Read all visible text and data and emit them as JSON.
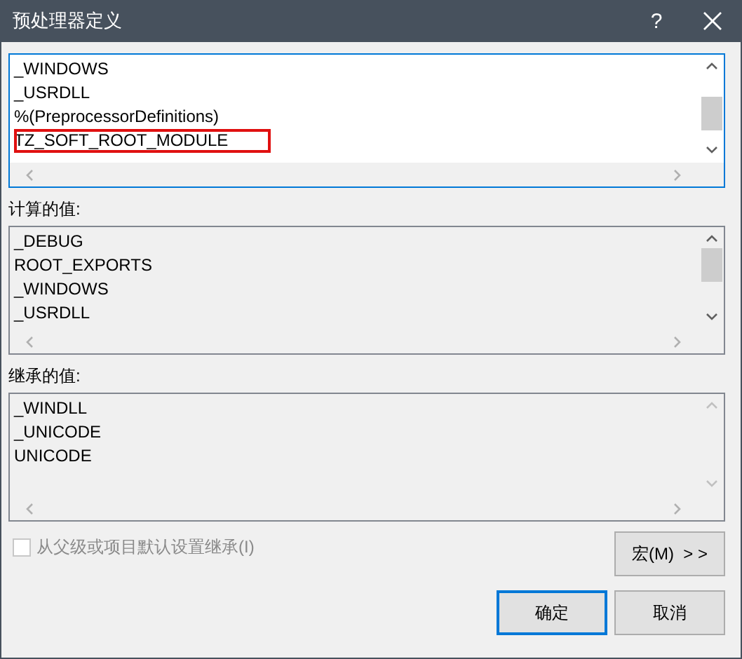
{
  "window": {
    "title": "预处理器定义",
    "help": "?"
  },
  "editor": {
    "focused": true,
    "lines": [
      {
        "text": "_WINDOWS",
        "highlighted": false
      },
      {
        "text": "_USRDLL",
        "highlighted": false
      },
      {
        "text": "%(PreprocessorDefinitions)",
        "highlighted": false
      },
      {
        "text": "TZ_SOFT_ROOT_MODULE",
        "highlighted": true
      }
    ]
  },
  "computed": {
    "label": "计算的值:",
    "lines": [
      "_DEBUG",
      "ROOT_EXPORTS",
      "_WINDOWS",
      "_USRDLL"
    ]
  },
  "inherited": {
    "label": "继承的值:",
    "lines": [
      "_WINDLL",
      "_UNICODE",
      "UNICODE"
    ]
  },
  "inherit_checkbox": {
    "label": "从父级或项目默认设置继承(I)",
    "checked": false,
    "disabled": true
  },
  "macro_button": {
    "label": "宏(M)  > >"
  },
  "buttons": [
    {
      "label": "确定",
      "default": true
    },
    {
      "label": "取消",
      "default": false
    }
  ]
}
